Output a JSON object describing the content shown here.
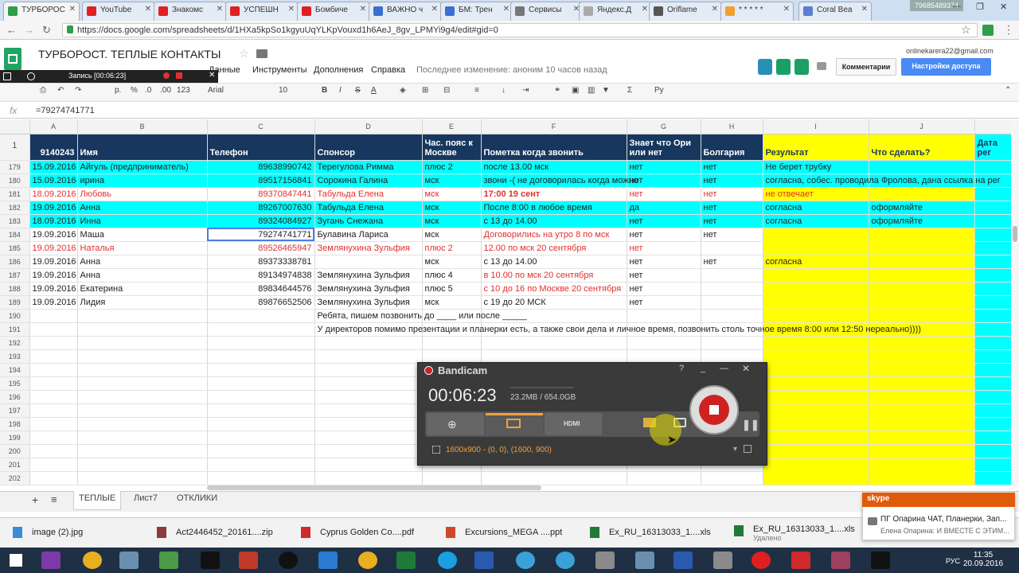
{
  "browser": {
    "tabs": [
      "ТУРБОРОС",
      "YouTube",
      "Знакомс",
      "УСПЕШН",
      "Бомбиче",
      "ВАЖНО ч",
      "БМ: Трен",
      "Сервисы",
      "Яндекс.Д",
      "Oriflame",
      "* * * * *",
      "Coral Bea"
    ],
    "tab_colors": [
      "#2e9e48",
      "#e02020",
      "#e02020",
      "#e02020",
      "#e02020",
      "#3a6fd0",
      "#3a6fd0",
      "#777",
      "#aaa",
      "#555",
      "#f0a030",
      "#5a7fd0"
    ],
    "phone": "79685489374",
    "url": "https://docs.google.com/spreadsheets/d/1HXa5kpSo1kgyuUqYLKpVouxd1h6AeJ_8gv_LPMYi9g4/edit#gid=0"
  },
  "sheets": {
    "title": "ТУРБОРОСТ. ТЕПЛЫЕ КОНТАКТЫ",
    "menus": [
      "Данные",
      "Инструменты",
      "Дополнения",
      "Справка"
    ],
    "last_edit": "Последнее изменение: аноним 10 часов назад",
    "email": "onlinekarera22@gmail.com",
    "comments_btn": "Комментарии",
    "share_btn": "Настройки доступа",
    "recording_label": "Запись [00:06:23]",
    "toolbar": {
      "pct": "%",
      "dec0": ".0",
      "dec00": ".00",
      "fmt": "123",
      "font": "Arial",
      "size": "10",
      "bold": "B",
      "italic": "I",
      "strike": "S",
      "text": "A",
      "sigma": "Σ",
      "lang": "Ру",
      "p": "р."
    },
    "formula_value": "=79274741771",
    "columns": [
      "A",
      "B",
      "C",
      "D",
      "E",
      "F",
      "G",
      "H",
      "I",
      "J"
    ],
    "header": {
      "rownum": "1",
      "a": "9140243",
      "b": "Имя",
      "c": "Телефон",
      "d": "Спонсор",
      "e": "Час. пояс к Москве",
      "f": "Пометка когда звонить",
      "g": "Знает что Ори или нет",
      "h": "Болгария",
      "i": "Результат",
      "j": "Что сделать?",
      "k": "Дата рег"
    },
    "rows": [
      {
        "n": "179",
        "a": "15.09.2016",
        "b": "Айгуль (предприниматель)",
        "c": "89638990742",
        "d": "Терегулова Римма",
        "e": "плюс 2",
        "f": "после 13.00 мск",
        "g": "нет",
        "h": "нет",
        "i": "Не берет трубку",
        "j": "",
        "style": "cyan"
      },
      {
        "n": "180",
        "a": "15.09.2016",
        "b": "ирина",
        "c": "89517156841",
        "d": "Сорокина Галина",
        "e": "мск",
        "f": "звони -( не договорилась когда можно",
        "g": "нет",
        "h": "нет",
        "i": "согласна, собес. проводила Фролова, дана ссылка на рег",
        "j": "",
        "style": "cyan"
      },
      {
        "n": "181",
        "a": "18.09.2016",
        "b": "Любовь",
        "c": "89370847441",
        "d": "Табульда Елена",
        "e": "мск",
        "f": "17:00 19 сент",
        "g": "нет",
        "h": "нет",
        "i": "не отвечает",
        "j": "",
        "style": "red"
      },
      {
        "n": "182",
        "a": "19.09.2016",
        "b": "Анна",
        "c": "89267007630",
        "d": "Табульда Елена",
        "e": "мск",
        "f": "После 8:00 в любое время",
        "g": "да",
        "h": "нет",
        "i": "согласна",
        "j": "оформляйте",
        "style": "cyan"
      },
      {
        "n": "183",
        "a": "18.09.2016",
        "b": "Инна",
        "c": "89324084927",
        "d": "Зугань Снежана",
        "e": "мск",
        "f": "с 13 до 14.00",
        "g": "нет",
        "h": "нет",
        "i": "согласна",
        "j": "оформляйте",
        "style": "cyan"
      },
      {
        "n": "184",
        "a": "19.09.2016",
        "b": "Маша",
        "c": "79274741771",
        "d": "Булавина Лариса",
        "e": "мск",
        "f": "Договорились  на утро 8 по мск",
        "g": "нет",
        "h": "нет",
        "i": "",
        "j": "",
        "style": "plain",
        "fred": true
      },
      {
        "n": "185",
        "a": "19.09.2016",
        "b": "Наталья",
        "c": "89526465947",
        "d": "Землянухина Зульфия",
        "e": "плюс 2",
        "f": "12.00 по мск 20 сентября",
        "g": "нет",
        "h": "",
        "i": "",
        "j": "",
        "style": "red"
      },
      {
        "n": "186",
        "a": "19.09.2016",
        "b": "Анна",
        "c": "89373338781",
        "d": "",
        "e": "мск",
        "f": "с 13 до 14.00",
        "g": "нет",
        "h": "нет",
        "i": "согласна",
        "j": "",
        "style": "plain"
      },
      {
        "n": "187",
        "a": "19.09.2016",
        "b": "Анна",
        "c": "89134974838",
        "d": "Землянухина Зульфия",
        "e": "плюс 4",
        "f": "в 10.00 по мск 20 сентября",
        "g": "нет",
        "h": "",
        "i": "",
        "j": "",
        "style": "plain",
        "fred": true
      },
      {
        "n": "188",
        "a": "19.09.2016",
        "b": "Екатерина",
        "c": "89834644576",
        "d": "Землянухина Зульфия",
        "e": "плюс 5",
        "f": "с 10 до 16 по Москве 20 сентября",
        "g": "нет",
        "h": "",
        "i": "",
        "j": "",
        "style": "plain",
        "fred": true
      },
      {
        "n": "189",
        "a": "19.09.2016",
        "b": "Лидия",
        "c": "89876652506",
        "d": "Землянухина Зульфия",
        "e": "мск",
        "f": "с 19 до 20 МСК",
        "g": "нет",
        "h": "",
        "i": "",
        "j": "",
        "style": "plain"
      },
      {
        "n": "190",
        "a": "",
        "b": "",
        "c": "",
        "d": "Ребята,  пишем позвонить до ____ или после _____",
        "e": "",
        "f": "",
        "g": "",
        "h": "",
        "i": "",
        "j": "",
        "style": "plain"
      },
      {
        "n": "191",
        "a": "",
        "b": "",
        "c": "",
        "d": "У директоров помимо презентации и планерки есть, а также  свои дела и личное время, позвонить столь точное время 8:00 или 12:50 нереально))))",
        "e": "",
        "f": "",
        "g": "",
        "h": "",
        "i": "",
        "j": "",
        "style": "plain"
      },
      {
        "n": "192",
        "style": "plain"
      },
      {
        "n": "193",
        "style": "plain"
      },
      {
        "n": "194",
        "style": "plain"
      },
      {
        "n": "195",
        "style": "plain"
      },
      {
        "n": "196",
        "style": "plain"
      },
      {
        "n": "197",
        "style": "plain"
      },
      {
        "n": "198",
        "style": "plain"
      },
      {
        "n": "199",
        "style": "plain"
      },
      {
        "n": "200",
        "style": "plain"
      },
      {
        "n": "201",
        "style": "plain"
      },
      {
        "n": "202",
        "style": "plain"
      }
    ],
    "sheet_tabs": [
      "ТЕПЛЫЕ",
      "Лист7",
      "ОТКЛИКИ"
    ]
  },
  "bandicam": {
    "title": "Bandicam",
    "time": "00:06:23",
    "size": "23.2MB / 654.0GB",
    "resolution": "1600x900 - (0, 0), (1600, 900)",
    "help": "?",
    "hdmi": "HDMI"
  },
  "downloads": [
    "image (2).jpg",
    "Act2446452_20161....zip",
    "Cyprus Golden Co....pdf",
    "Excursions_MEGA ....ppt",
    "Ex_RU_16313033_1....xls",
    "Ex_RU_16313033_1....xls"
  ],
  "download_note": "Удалено",
  "skype": {
    "header": "skype",
    "title": "ПГ Опарина ЧАТ, Планерки, Зап...",
    "msg": "Елена Опарина: И ВМЕСТЕ С ЭТИМ..."
  },
  "taskbar": {
    "time": "11:35",
    "date": "20.09.2016",
    "lang": "РУС"
  }
}
